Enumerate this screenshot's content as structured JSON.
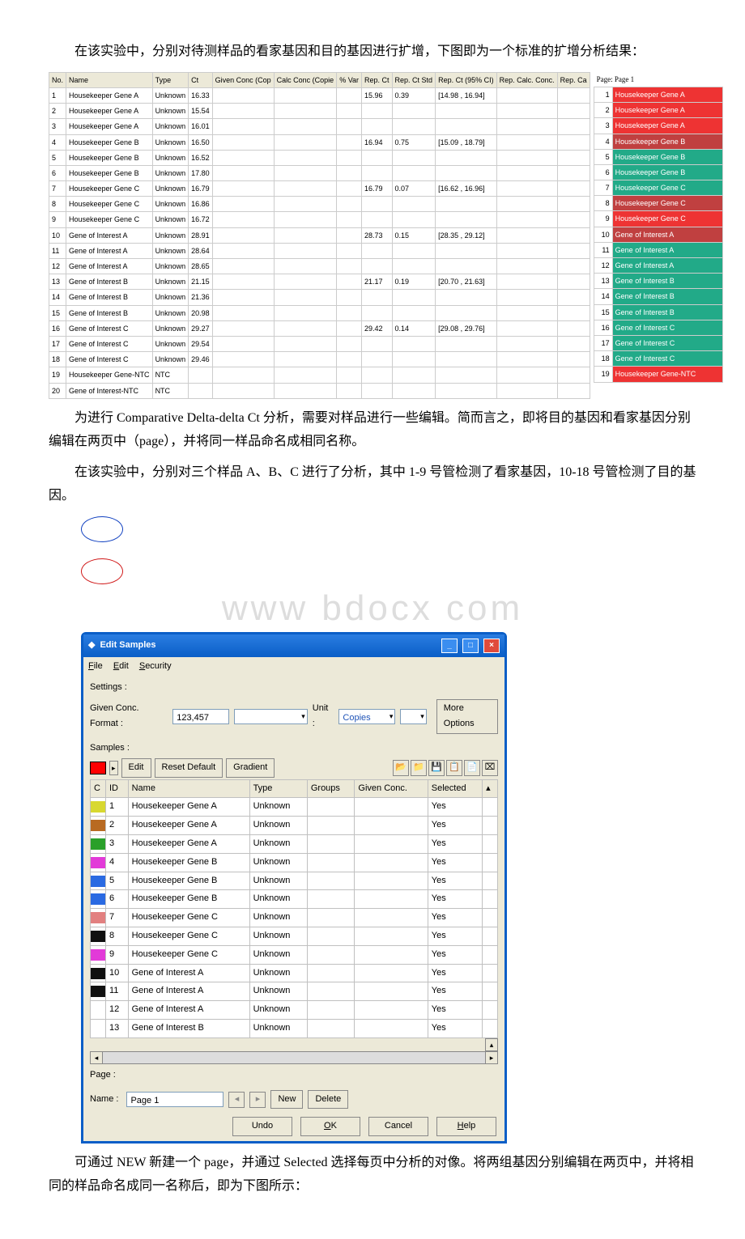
{
  "para1": "在该实验中，分别对待测样品的看家基因和目的基因进行扩增，下图即为一个标准的扩增分析结果：",
  "para2": "为进行 Comparative Delta-delta Ct 分析，需要对样品进行一些编辑。简而言之，即将目的基因和看家基因分别编辑在两页中（page），并将同一样品命名成相同名称。",
  "para3": "在该实验中，分别对三个样品 A、B、C 进行了分析，其中 1-9 号管检测了看家基因，10-18 号管检测了目的基因。",
  "watermark": "www bdocx com",
  "para4": "可通过 NEW 新建一个 page，并通过 Selected 选择每页中分析的对像。将两组基因分别编辑在两页中，并将相同的样品命名成同一名称后，即为下图所示：",
  "tbl1": {
    "headers": [
      "No.",
      "Name",
      "Type",
      "Ct",
      "Given Conc (Cop",
      "Calc Conc (Copie",
      "% Var",
      "Rep. Ct",
      "Rep. Ct Std",
      "Rep. Ct (95% CI)",
      "Rep. Calc. Conc.",
      "Rep. Ca"
    ],
    "rows": [
      {
        "no": "1",
        "name": "Housekeeper Gene  A",
        "type": "Unknown",
        "ct": "16.33",
        "rep": "15.96",
        "std": "0.39",
        "ci": "[14.98 , 16.94]"
      },
      {
        "no": "2",
        "name": "Housekeeper Gene  A",
        "type": "Unknown",
        "ct": "15.54",
        "rep": "",
        "std": "",
        "ci": ""
      },
      {
        "no": "3",
        "name": "Housekeeper Gene  A",
        "type": "Unknown",
        "ct": "16.01",
        "rep": "",
        "std": "",
        "ci": ""
      },
      {
        "no": "4",
        "name": "Housekeeper Gene  B",
        "type": "Unknown",
        "ct": "16.50",
        "rep": "16.94",
        "std": "0.75",
        "ci": "[15.09 , 18.79]"
      },
      {
        "no": "5",
        "name": "Housekeeper Gene  B",
        "type": "Unknown",
        "ct": "16.52",
        "rep": "",
        "std": "",
        "ci": ""
      },
      {
        "no": "6",
        "name": "Housekeeper Gene  B",
        "type": "Unknown",
        "ct": "17.80",
        "rep": "",
        "std": "",
        "ci": ""
      },
      {
        "no": "7",
        "name": "Housekeeper Gene  C",
        "type": "Unknown",
        "ct": "16.79",
        "rep": "16.79",
        "std": "0.07",
        "ci": "[16.62 , 16.96]"
      },
      {
        "no": "8",
        "name": "Housekeeper Gene  C",
        "type": "Unknown",
        "ct": "16.86",
        "rep": "",
        "std": "",
        "ci": ""
      },
      {
        "no": "9",
        "name": "Housekeeper Gene  C",
        "type": "Unknown",
        "ct": "16.72",
        "rep": "",
        "std": "",
        "ci": ""
      },
      {
        "no": "10",
        "name": "Gene of Interest  A",
        "type": "Unknown",
        "ct": "28.91",
        "rep": "28.73",
        "std": "0.15",
        "ci": "[28.35 , 29.12]"
      },
      {
        "no": "11",
        "name": "Gene of Interest  A",
        "type": "Unknown",
        "ct": "28.64",
        "rep": "",
        "std": "",
        "ci": ""
      },
      {
        "no": "12",
        "name": "Gene of Interest  A",
        "type": "Unknown",
        "ct": "28.65",
        "rep": "",
        "std": "",
        "ci": ""
      },
      {
        "no": "13",
        "name": "Gene of Interest  B",
        "type": "Unknown",
        "ct": "21.15",
        "rep": "21.17",
        "std": "0.19",
        "ci": "[20.70 , 21.63]"
      },
      {
        "no": "14",
        "name": "Gene of Interest  B",
        "type": "Unknown",
        "ct": "21.36",
        "rep": "",
        "std": "",
        "ci": ""
      },
      {
        "no": "15",
        "name": "Gene of Interest  B",
        "type": "Unknown",
        "ct": "20.98",
        "rep": "",
        "std": "",
        "ci": ""
      },
      {
        "no": "16",
        "name": "Gene of Interest  C",
        "type": "Unknown",
        "ct": "29.27",
        "rep": "29.42",
        "std": "0.14",
        "ci": "[29.08 , 29.76]"
      },
      {
        "no": "17",
        "name": "Gene of Interest  C",
        "type": "Unknown",
        "ct": "29.54",
        "rep": "",
        "std": "",
        "ci": ""
      },
      {
        "no": "18",
        "name": "Gene of Interest  C",
        "type": "Unknown",
        "ct": "29.46",
        "rep": "",
        "std": "",
        "ci": ""
      },
      {
        "no": "19",
        "name": "Housekeeper Gene-NTC",
        "type": "NTC",
        "ct": "",
        "rep": "",
        "std": "",
        "ci": ""
      },
      {
        "no": "20",
        "name": "Gene of Interest-NTC",
        "type": "NTC",
        "ct": "",
        "rep": "",
        "std": "",
        "ci": ""
      }
    ]
  },
  "pagebox": {
    "header": "Page: Page 1",
    "rows": [
      {
        "n": "1",
        "label": "Housekeeper Gene  A",
        "color": "#e33"
      },
      {
        "n": "2",
        "label": "Housekeeper Gene  A",
        "color": "#e33"
      },
      {
        "n": "3",
        "label": "Housekeeper Gene  A",
        "color": "#e33"
      },
      {
        "n": "4",
        "label": "Housekeeper Gene  B",
        "color": "#c04040"
      },
      {
        "n": "5",
        "label": "Housekeeper Gene  B",
        "color": "#2a8"
      },
      {
        "n": "6",
        "label": "Housekeeper Gene  B",
        "color": "#2a8"
      },
      {
        "n": "7",
        "label": "Housekeeper Gene  C",
        "color": "#2a8"
      },
      {
        "n": "8",
        "label": "Housekeeper Gene  C",
        "color": "#c04040"
      },
      {
        "n": "9",
        "label": "Housekeeper Gene  C",
        "color": "#e33"
      },
      {
        "n": "10",
        "label": "Gene of Interest  A",
        "color": "#c04040"
      },
      {
        "n": "11",
        "label": "Gene of Interest  A",
        "color": "#2a8"
      },
      {
        "n": "12",
        "label": "Gene of Interest  A",
        "color": "#2a8"
      },
      {
        "n": "13",
        "label": "Gene of Interest  B",
        "color": "#2a8"
      },
      {
        "n": "14",
        "label": "Gene of Interest  B",
        "color": "#2a8"
      },
      {
        "n": "15",
        "label": "Gene of Interest  B",
        "color": "#2a8"
      },
      {
        "n": "16",
        "label": "Gene of Interest  C",
        "color": "#2a8"
      },
      {
        "n": "17",
        "label": "Gene of Interest  C",
        "color": "#2a8"
      },
      {
        "n": "18",
        "label": "Gene of Interest  C",
        "color": "#2a8"
      },
      {
        "n": "19",
        "label": "Housekeeper Gene-NTC",
        "color": "#e33"
      }
    ]
  },
  "win": {
    "title": "Edit Samples",
    "menu_file": "File",
    "menu_edit": "Edit",
    "menu_security": "Security",
    "settings_label": "Settings :",
    "given_conc_format_label": "Given Conc. Format :",
    "given_conc_format_value": "123,457",
    "unit_label": "Unit :",
    "unit_value": "Copies",
    "more_options": "More Options",
    "samples_label": "Samples :",
    "edit_btn": "Edit",
    "reset_btn": "Reset Default",
    "gradient_btn": "Gradient",
    "grid_headers": [
      "C",
      "ID",
      "Name",
      "Type",
      "Groups",
      "Given Conc.",
      "Selected"
    ],
    "rows": [
      {
        "c": "#d8d830",
        "id": "1",
        "name": "Housekeeper Gene  A",
        "type": "Unknown",
        "groups": "",
        "conc": "",
        "sel": "Yes"
      },
      {
        "c": "#b86a22",
        "id": "2",
        "name": "Housekeeper Gene  A",
        "type": "Unknown",
        "groups": "",
        "conc": "",
        "sel": "Yes"
      },
      {
        "c": "#2aa02a",
        "id": "3",
        "name": "Housekeeper Gene  A",
        "type": "Unknown",
        "groups": "",
        "conc": "",
        "sel": "Yes"
      },
      {
        "c": "#e23ad8",
        "id": "4",
        "name": "Housekeeper Gene  B",
        "type": "Unknown",
        "groups": "",
        "conc": "",
        "sel": "Yes"
      },
      {
        "c": "#2a6ae2",
        "id": "5",
        "name": "Housekeeper Gene  B",
        "type": "Unknown",
        "groups": "",
        "conc": "",
        "sel": "Yes"
      },
      {
        "c": "#2a6ae2",
        "id": "6",
        "name": "Housekeeper Gene  B",
        "type": "Unknown",
        "groups": "",
        "conc": "",
        "sel": "Yes"
      },
      {
        "c": "#e28080",
        "id": "7",
        "name": "Housekeeper Gene  C",
        "type": "Unknown",
        "groups": "",
        "conc": "",
        "sel": "Yes"
      },
      {
        "c": "#101010",
        "id": "8",
        "name": "Housekeeper Gene  C",
        "type": "Unknown",
        "groups": "",
        "conc": "",
        "sel": "Yes"
      },
      {
        "c": "#e23ad8",
        "id": "9",
        "name": "Housekeeper Gene  C",
        "type": "Unknown",
        "groups": "",
        "conc": "",
        "sel": "Yes"
      },
      {
        "c": "#101010",
        "id": "10",
        "name": "Gene of Interest  A",
        "type": "Unknown",
        "groups": "",
        "conc": "",
        "sel": "Yes"
      },
      {
        "c": "#101010",
        "id": "11",
        "name": "Gene of Interest  A",
        "type": "Unknown",
        "groups": "",
        "conc": "",
        "sel": "Yes"
      },
      {
        "c": "",
        "id": "12",
        "name": "Gene of Interest  A",
        "type": "Unknown",
        "groups": "",
        "conc": "",
        "sel": "Yes"
      },
      {
        "c": "",
        "id": "13",
        "name": "Gene of Interest  B",
        "type": "Unknown",
        "groups": "",
        "conc": "",
        "sel": "Yes"
      }
    ],
    "page_label": "Page :",
    "name_label": "Name :",
    "name_value": "Page 1",
    "new_btn": "New",
    "delete_btn": "Delete",
    "undo_btn": "Undo",
    "ok_btn": "OK",
    "cancel_btn": "Cancel",
    "help_btn": "Help"
  }
}
